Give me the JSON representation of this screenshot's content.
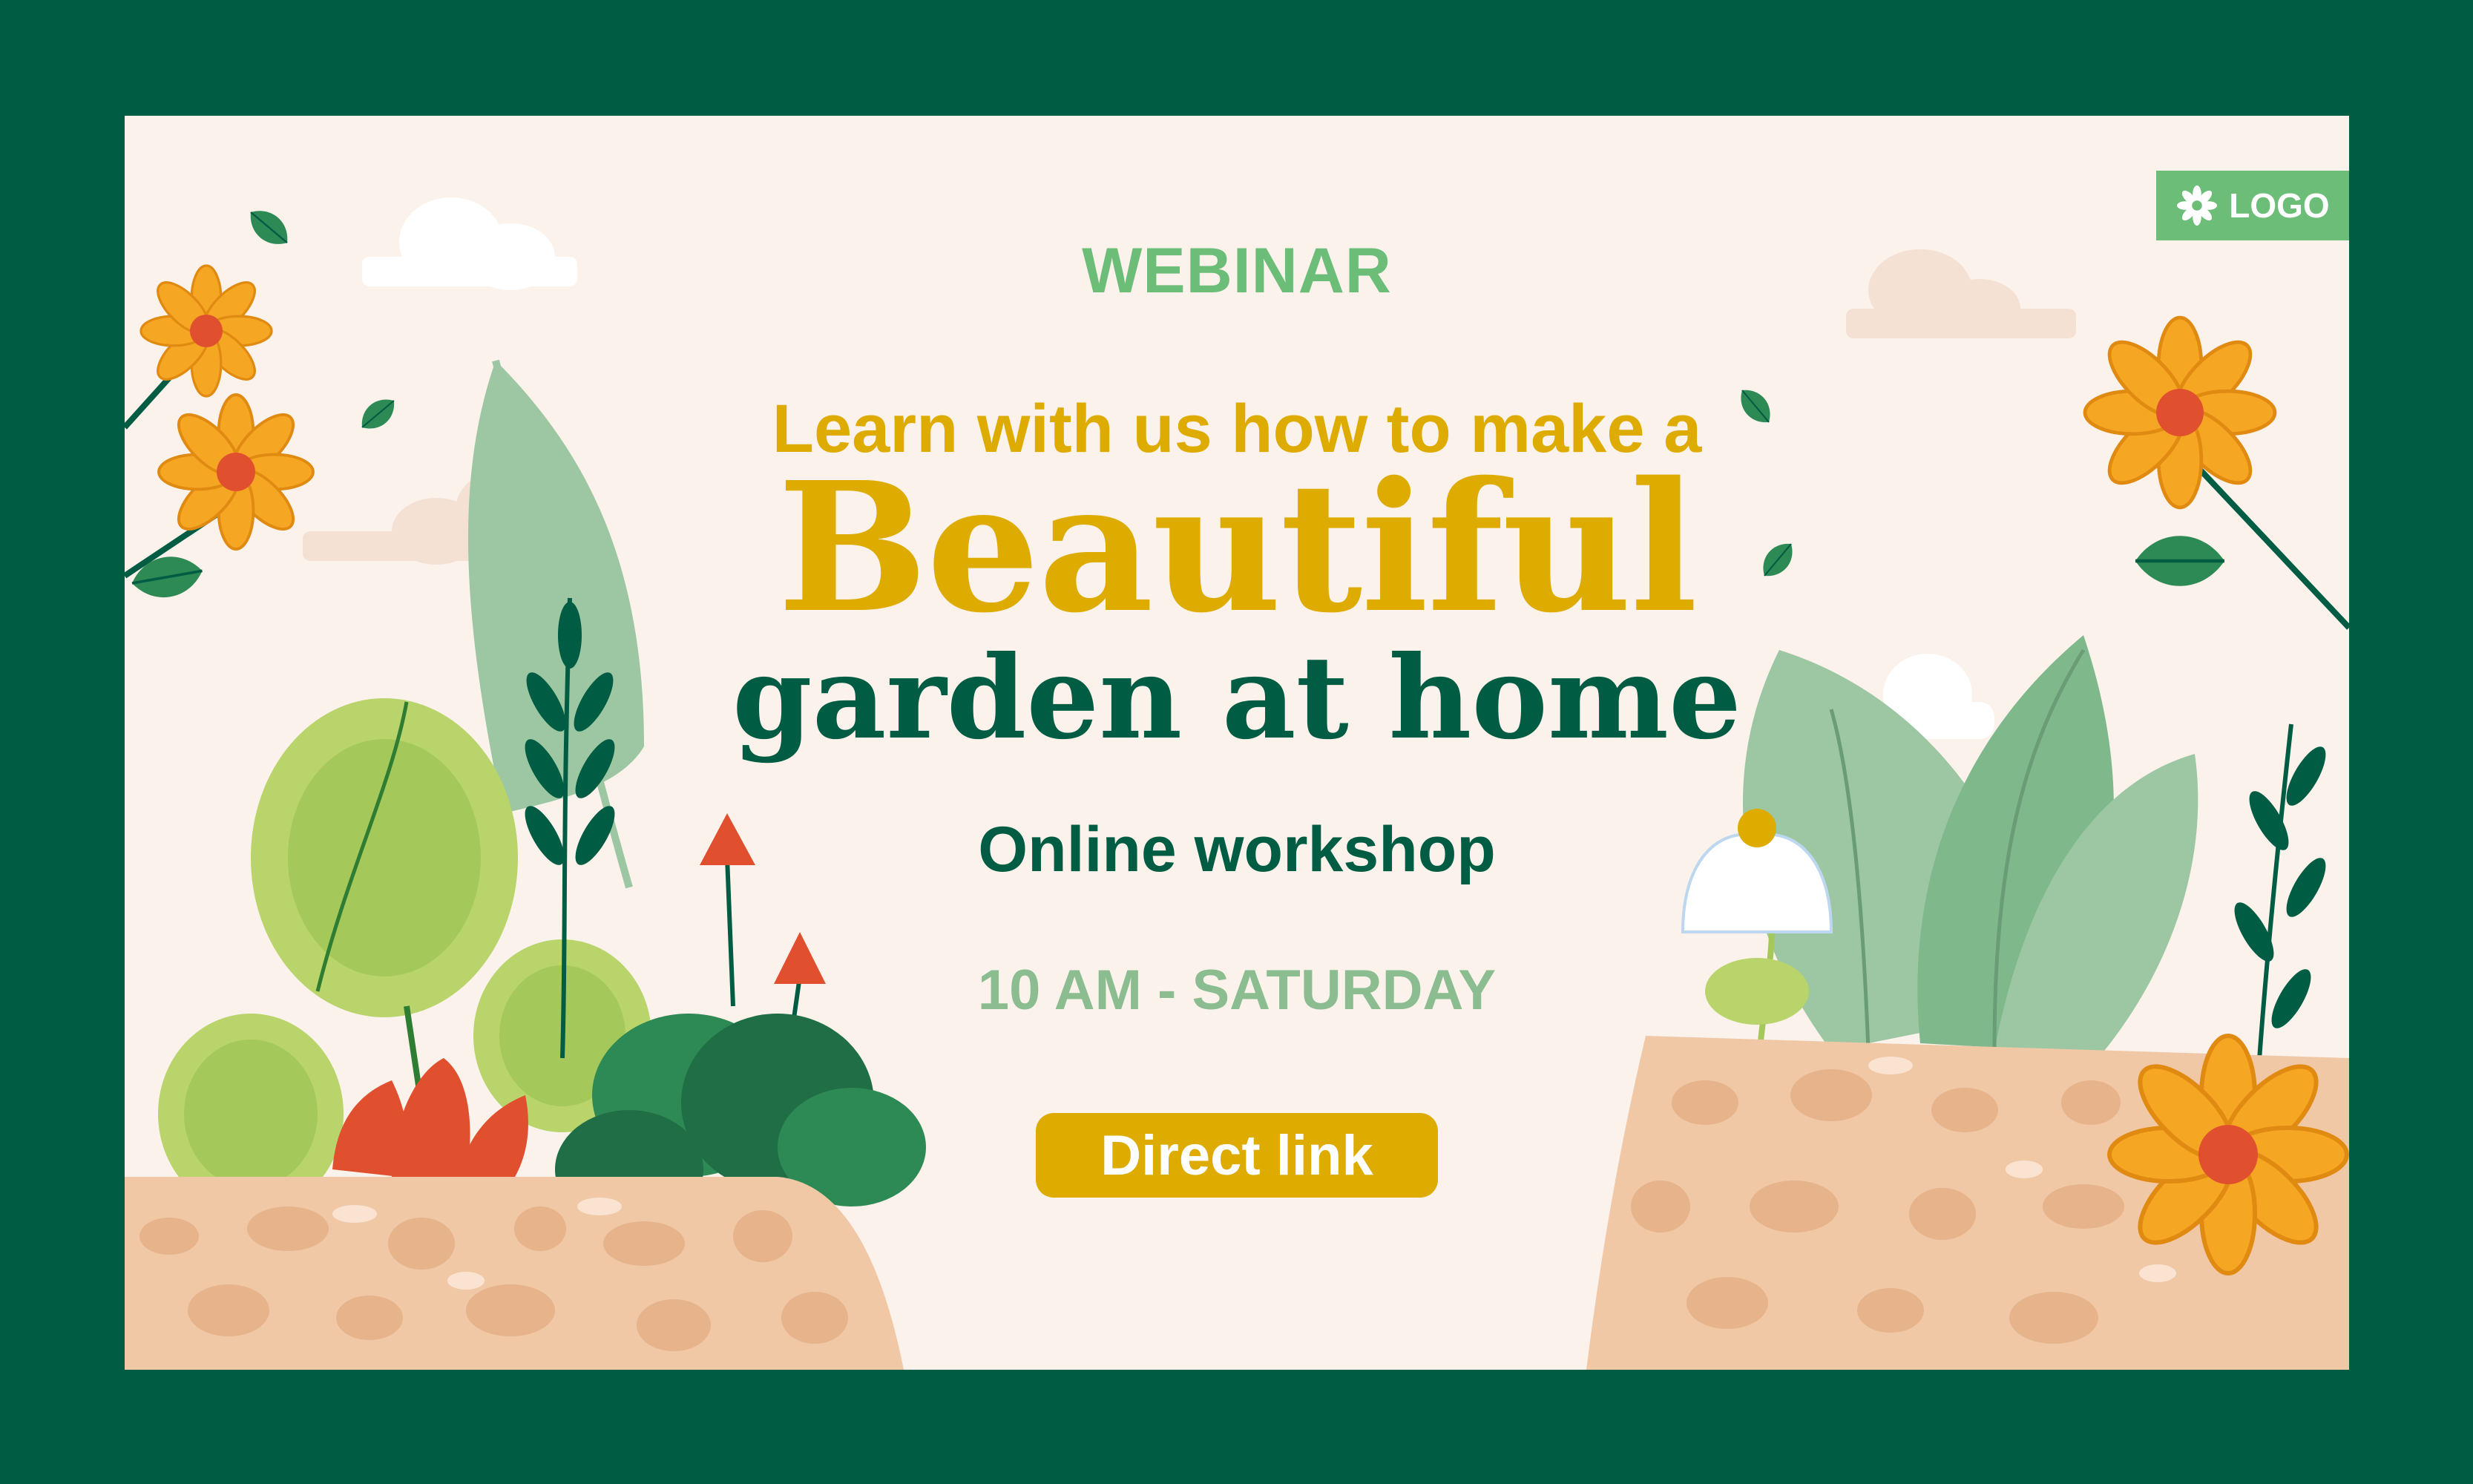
{
  "banner": {
    "eyebrow": "WEBINAR",
    "lead_line": "Learn with us how to make a",
    "headline": "Beautiful",
    "headline_sub": "garden at home",
    "subtitle": "Online workshop",
    "schedule": "10 AM - SATURDAY",
    "cta_label": "Direct link",
    "logo_label": "LOGO"
  },
  "colors": {
    "frame": "#005c42",
    "background": "#fbf2ec",
    "accent_yellow": "#deab00",
    "accent_green": "#6cbd78",
    "dark_green": "#005c42",
    "muted_green": "#8bbd90"
  },
  "icons": {
    "logo": "flower-icon"
  }
}
